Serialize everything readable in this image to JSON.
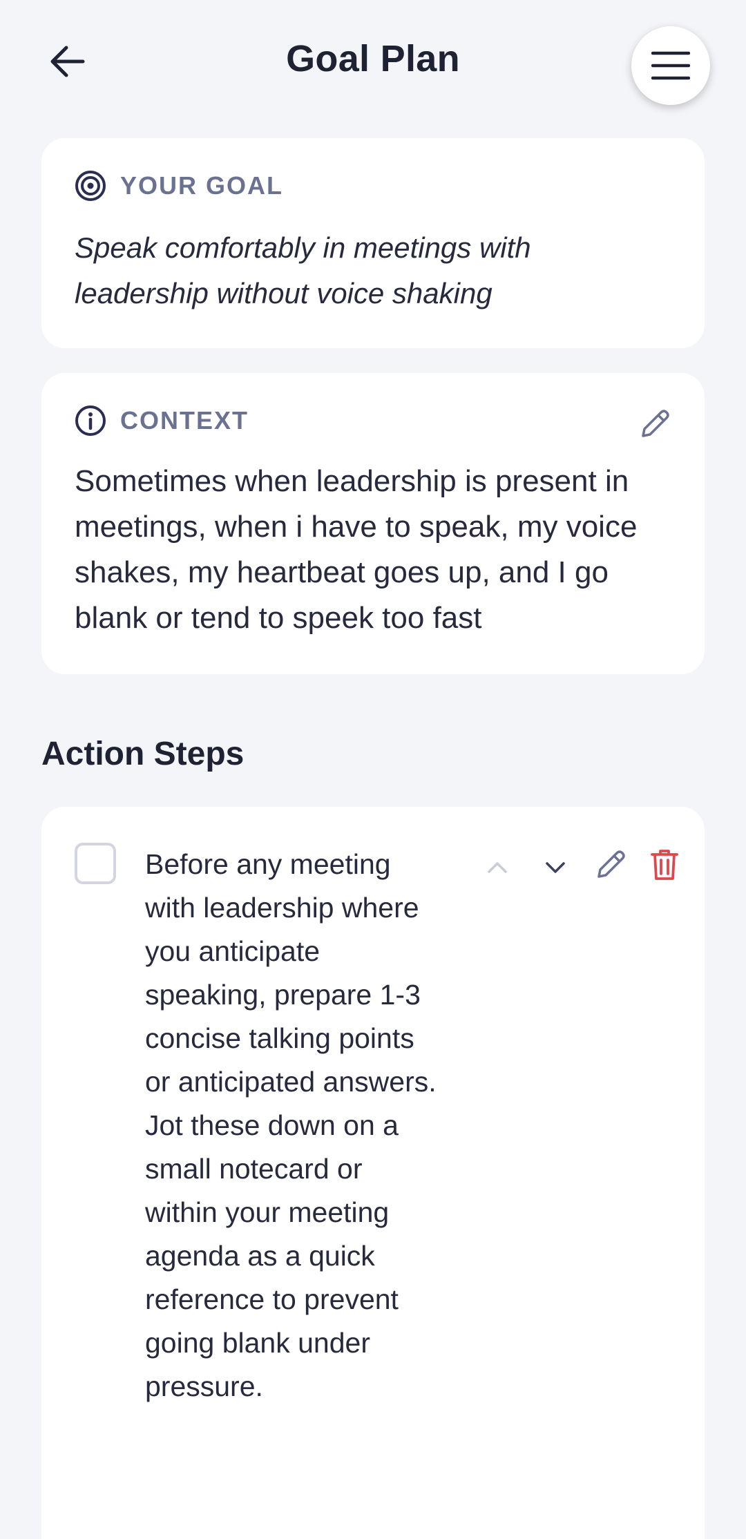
{
  "header": {
    "title": "Goal Plan"
  },
  "goal": {
    "label": "YOUR GOAL",
    "text": "Speak comfortably in meetings with leadership without voice shaking"
  },
  "context": {
    "label": "CONTEXT",
    "text": "Sometimes when leadership is present in meetings, when i have to speak, my voice shakes, my heartbeat goes up, and I go blank or tend to speek too fast"
  },
  "action_steps": {
    "title": "Action Steps",
    "items": [
      {
        "checked": false,
        "text": "Before any meeting with leadership where you anticipate speaking, prepare 1-3 concise talking points or anticipated answers. Jot these down on a small notecard or within your meeting agenda as a quick reference to prevent going blank under pressure."
      }
    ]
  },
  "colors": {
    "background": "#f4f5f9",
    "card": "#ffffff",
    "label": "#6b7190",
    "icon_dark": "#2a2f52",
    "delete": "#e0474c",
    "disabled": "#c9ccd6"
  }
}
